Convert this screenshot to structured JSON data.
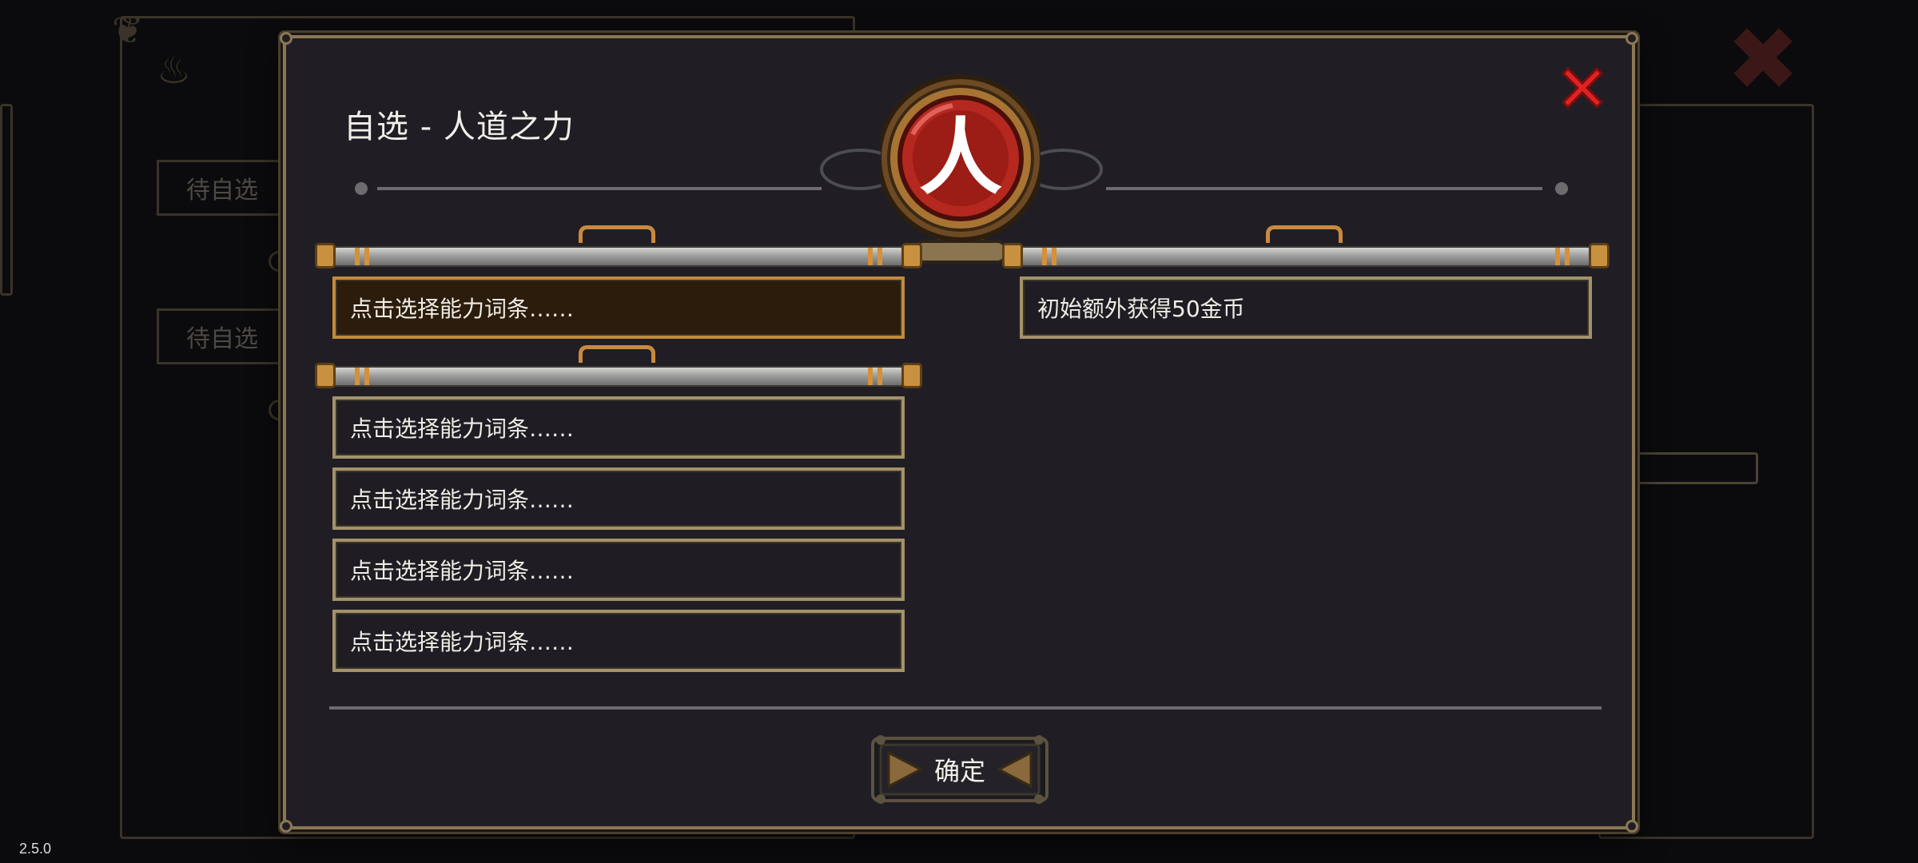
{
  "background": {
    "pending_labels": [
      "待自选",
      "待自选"
    ],
    "version": "2.5.0"
  },
  "dialog": {
    "title": "自选 - 人道之力",
    "emblem_glyph": "人",
    "left_slots": [
      {
        "label": "点击选择能力词条……",
        "selected": true
      },
      {
        "label": "点击选择能力词条……",
        "selected": false
      },
      {
        "label": "点击选择能力词条……",
        "selected": false
      },
      {
        "label": "点击选择能力词条……",
        "selected": false
      },
      {
        "label": "点击选择能力词条……",
        "selected": false
      }
    ],
    "right_slots": [
      {
        "label": "初始额外获得50金币"
      }
    ],
    "confirm_label": "确定"
  },
  "colors": {
    "panel": "#201e24",
    "frame": "#8b7752",
    "close": "#e02222",
    "emblem": "#b5281f",
    "selected_slot": "#2b1c0b",
    "copper": "#c98a3d"
  },
  "icons": {
    "close": "close-x-icon",
    "emblem": "human-emblem-icon"
  }
}
